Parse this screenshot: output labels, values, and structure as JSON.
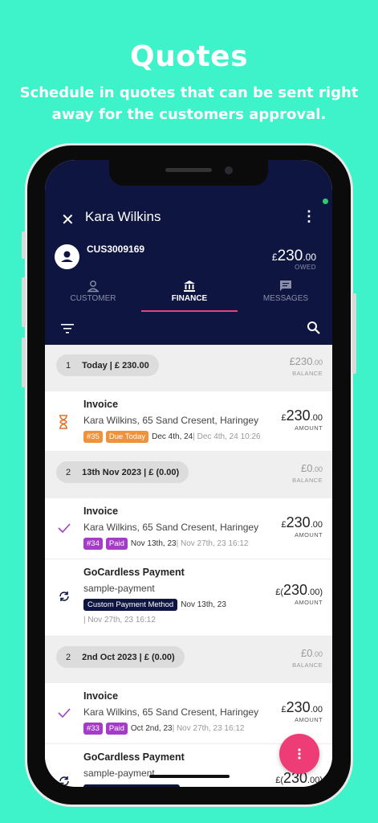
{
  "promo": {
    "title": "Quotes",
    "subtitle": "Schedule in quotes that can be sent right away for the customers approval."
  },
  "header": {
    "customer_name": "Kara Wilkins",
    "customer_id": "CUS3009169",
    "owed_currency": "£",
    "owed_whole": "230",
    "owed_decimal": ".00",
    "owed_label": "OWED"
  },
  "tabs": [
    {
      "label": "CUSTOMER",
      "icon": "person-icon",
      "active": false
    },
    {
      "label": "FINANCE",
      "icon": "bank-icon",
      "active": true
    },
    {
      "label": "MESSAGES",
      "icon": "message-icon",
      "active": false
    }
  ],
  "groups": [
    {
      "count": "1",
      "label": "Today | £ 230.00",
      "balance_whole": "£230",
      "balance_decimal": ".00",
      "balance_label": "BALANCE",
      "items": [
        {
          "type": "Invoice",
          "icon": "hourglass-icon",
          "desc": "Kara Wilkins, 65 Sand Cresent, Haringey",
          "badge_no": "#35",
          "status": "Due Today",
          "date": "Dec 4th, 24",
          "date2": " | Dec 4th, 24 10:26",
          "amount_whole": "230",
          "amount_decimal": ".00",
          "amount_label": "AMOUNT"
        }
      ]
    },
    {
      "count": "2",
      "label": "13th Nov 2023 | £ (0.00)",
      "balance_whole": "£0",
      "balance_decimal": ".00",
      "balance_label": "BALANCE",
      "items": [
        {
          "type": "Invoice",
          "icon": "check-icon",
          "desc": "Kara Wilkins, 65 Sand Cresent, Haringey",
          "badge_no": "#34",
          "status": "Paid",
          "date": "Nov 13th, 23",
          "date2": " | Nov 27th, 23 16:12",
          "amount_whole": "230",
          "amount_decimal": ".00",
          "amount_label": "AMOUNT"
        },
        {
          "type": "GoCardless Payment",
          "icon": "sync-icon",
          "desc": "sample-payment",
          "method": "Custom Payment Method",
          "date": "Nov 13th, 23",
          "date2": "| Nov 27th, 23 16:12",
          "amount_prefix": "£(",
          "amount_whole": "230",
          "amount_decimal": ".00)",
          "amount_label": "AMOUNT"
        }
      ]
    },
    {
      "count": "2",
      "label": "2nd Oct 2023 | £ (0.00)",
      "balance_whole": "£0",
      "balance_decimal": ".00",
      "balance_label": "BALANCE",
      "items": [
        {
          "type": "Invoice",
          "icon": "check-icon",
          "desc": "Kara Wilkins, 65 Sand Cresent, Haringey",
          "badge_no": "#33",
          "status": "Paid",
          "date": "Oct 2nd, 23",
          "date2": " | Nov 27th, 23 16:12",
          "amount_whole": "230",
          "amount_decimal": ".00",
          "amount_label": "AMOUNT"
        },
        {
          "type": "GoCardless Payment",
          "icon": "sync-icon",
          "desc": "sample-payment",
          "amount_prefix": "£(",
          "amount_whole": "230",
          "amount_decimal": ".00)"
        }
      ]
    }
  ],
  "colors": {
    "background": "#3ef2c9",
    "header": "#0e1541",
    "accent": "#e0457b",
    "due_today": "#f0923a",
    "paid": "#a43cc8",
    "fab": "#ee3c76"
  },
  "fab_icon": "more-vertical-icon"
}
